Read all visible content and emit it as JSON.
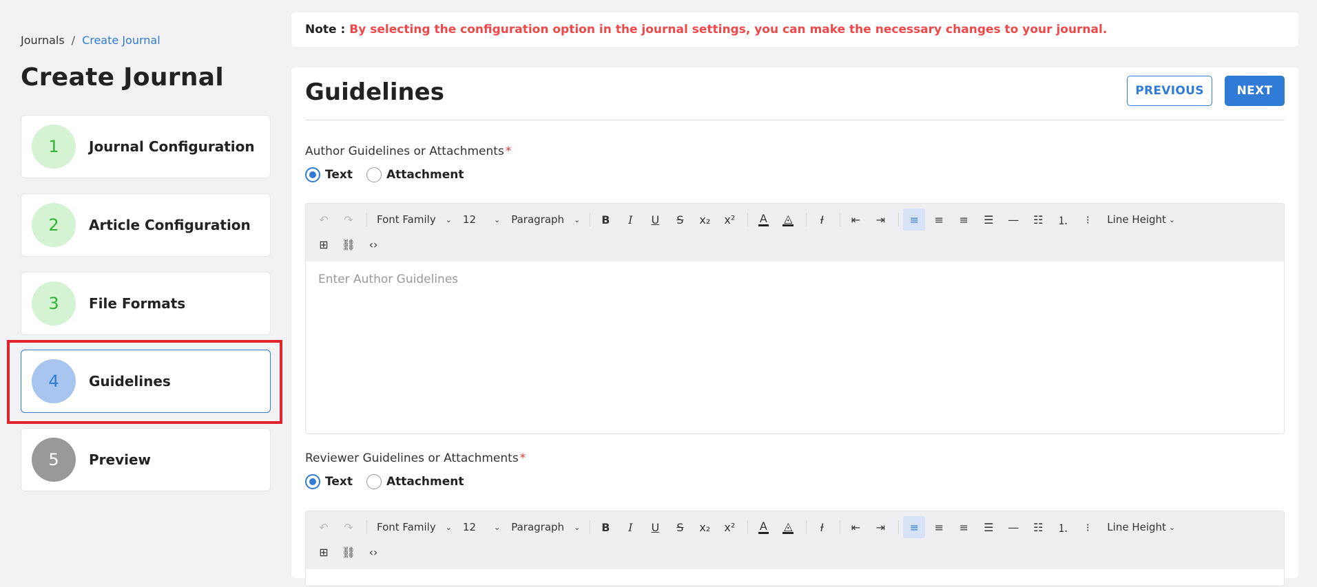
{
  "breadcrumb": {
    "parent": "Journals",
    "separator": "/",
    "current": "Create Journal"
  },
  "page_title": "Create Journal",
  "steps": [
    {
      "number": "1",
      "label": "Journal Configuration",
      "state": "done"
    },
    {
      "number": "2",
      "label": "Article Configuration",
      "state": "done"
    },
    {
      "number": "3",
      "label": "File Formats",
      "state": "done"
    },
    {
      "number": "4",
      "label": "Guidelines",
      "state": "active"
    },
    {
      "number": "5",
      "label": "Preview",
      "state": "pending"
    }
  ],
  "note": {
    "label": "Note :",
    "text": "By selecting the configuration option in the journal settings, you can make the necessary changes to your journal."
  },
  "card": {
    "title": "Guidelines",
    "previous_label": "PREVIOUS",
    "next_label": "NEXT"
  },
  "toolbar": {
    "font_family": "Font Family",
    "font_size": "12",
    "block": "Paragraph",
    "line_height": "Line Height"
  },
  "author_section": {
    "label": "Author Guidelines or Attachments",
    "required_mark": "*",
    "option_text": "Text",
    "option_attachment": "Attachment",
    "selected": "Text",
    "placeholder": "Enter Author Guidelines"
  },
  "reviewer_section": {
    "label": "Reviewer Guidelines or Attachments",
    "required_mark": "*",
    "option_text": "Text",
    "option_attachment": "Attachment",
    "selected": "Text"
  },
  "colors": {
    "accent": "#2f7bd6",
    "note_text": "#f04848",
    "done_step": "#d4f3d3",
    "active_step": "#a7c5ef",
    "highlight": "#e0242d"
  }
}
